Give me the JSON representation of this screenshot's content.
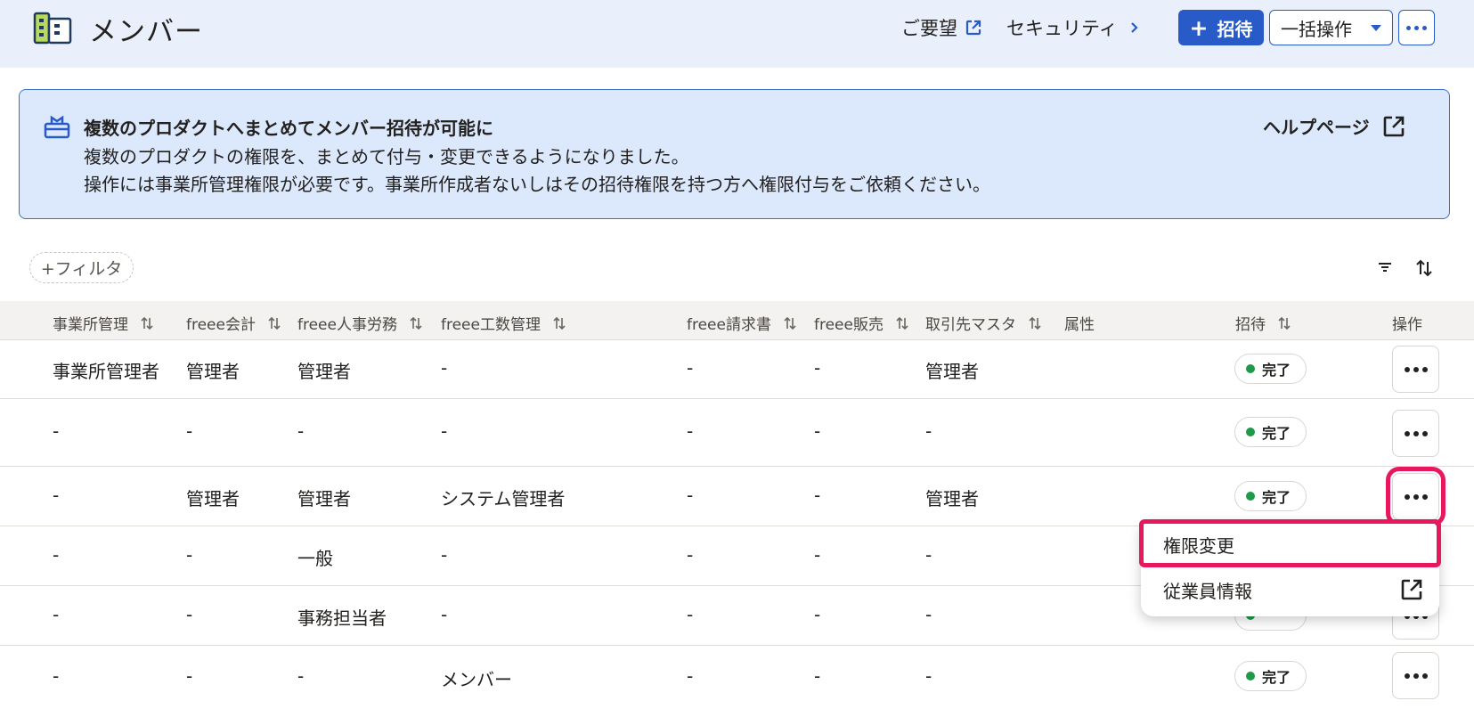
{
  "header": {
    "title": "メンバー",
    "feedback_link": "ご要望",
    "security_link": "セキュリティ",
    "invite_button": "招待",
    "bulk_button": "一括操作",
    "accent_color": "#285ac8"
  },
  "notice": {
    "title": "複数のプロダクトへまとめてメンバー招待が可能に",
    "line1": "複数のプロダクトの権限を、まとめて付与・変更できるようになりました。",
    "line2": "操作には事業所管理権限が必要です。事業所作成者ないしはその招待権限を持つ方へ権限付与をご依頼ください。",
    "help_link": "ヘルプページ"
  },
  "toolbar": {
    "filter_label": "+フィルタ"
  },
  "table": {
    "columns": [
      "事業所管理",
      "freee会計",
      "freee人事労務",
      "freee工数管理",
      "freee請求書",
      "freee販売",
      "取引先マスタ",
      "属性",
      "招待",
      "操作"
    ],
    "rows": [
      [
        "事業所管理者",
        "管理者",
        "管理者",
        "-",
        "-",
        "-",
        "管理者",
        "",
        "完了"
      ],
      [
        "-",
        "-",
        "-",
        "-",
        "-",
        "-",
        "-",
        "",
        "完了"
      ],
      [
        "-",
        "管理者",
        "管理者",
        "システム管理者",
        "-",
        "-",
        "管理者",
        "",
        "完了"
      ],
      [
        "-",
        "-",
        "一般",
        "-",
        "-",
        "-",
        "-",
        "",
        ""
      ],
      [
        "-",
        "-",
        "事務担当者",
        "-",
        "-",
        "-",
        "-",
        "",
        ""
      ],
      [
        "-",
        "-",
        "-",
        "メンバー",
        "-",
        "-",
        "-",
        "",
        "完了"
      ]
    ],
    "status_color": "#1d9a47"
  },
  "row_menu": {
    "items": [
      "権限変更",
      "従業員情報"
    ],
    "highlight_color": "#e8185f"
  }
}
